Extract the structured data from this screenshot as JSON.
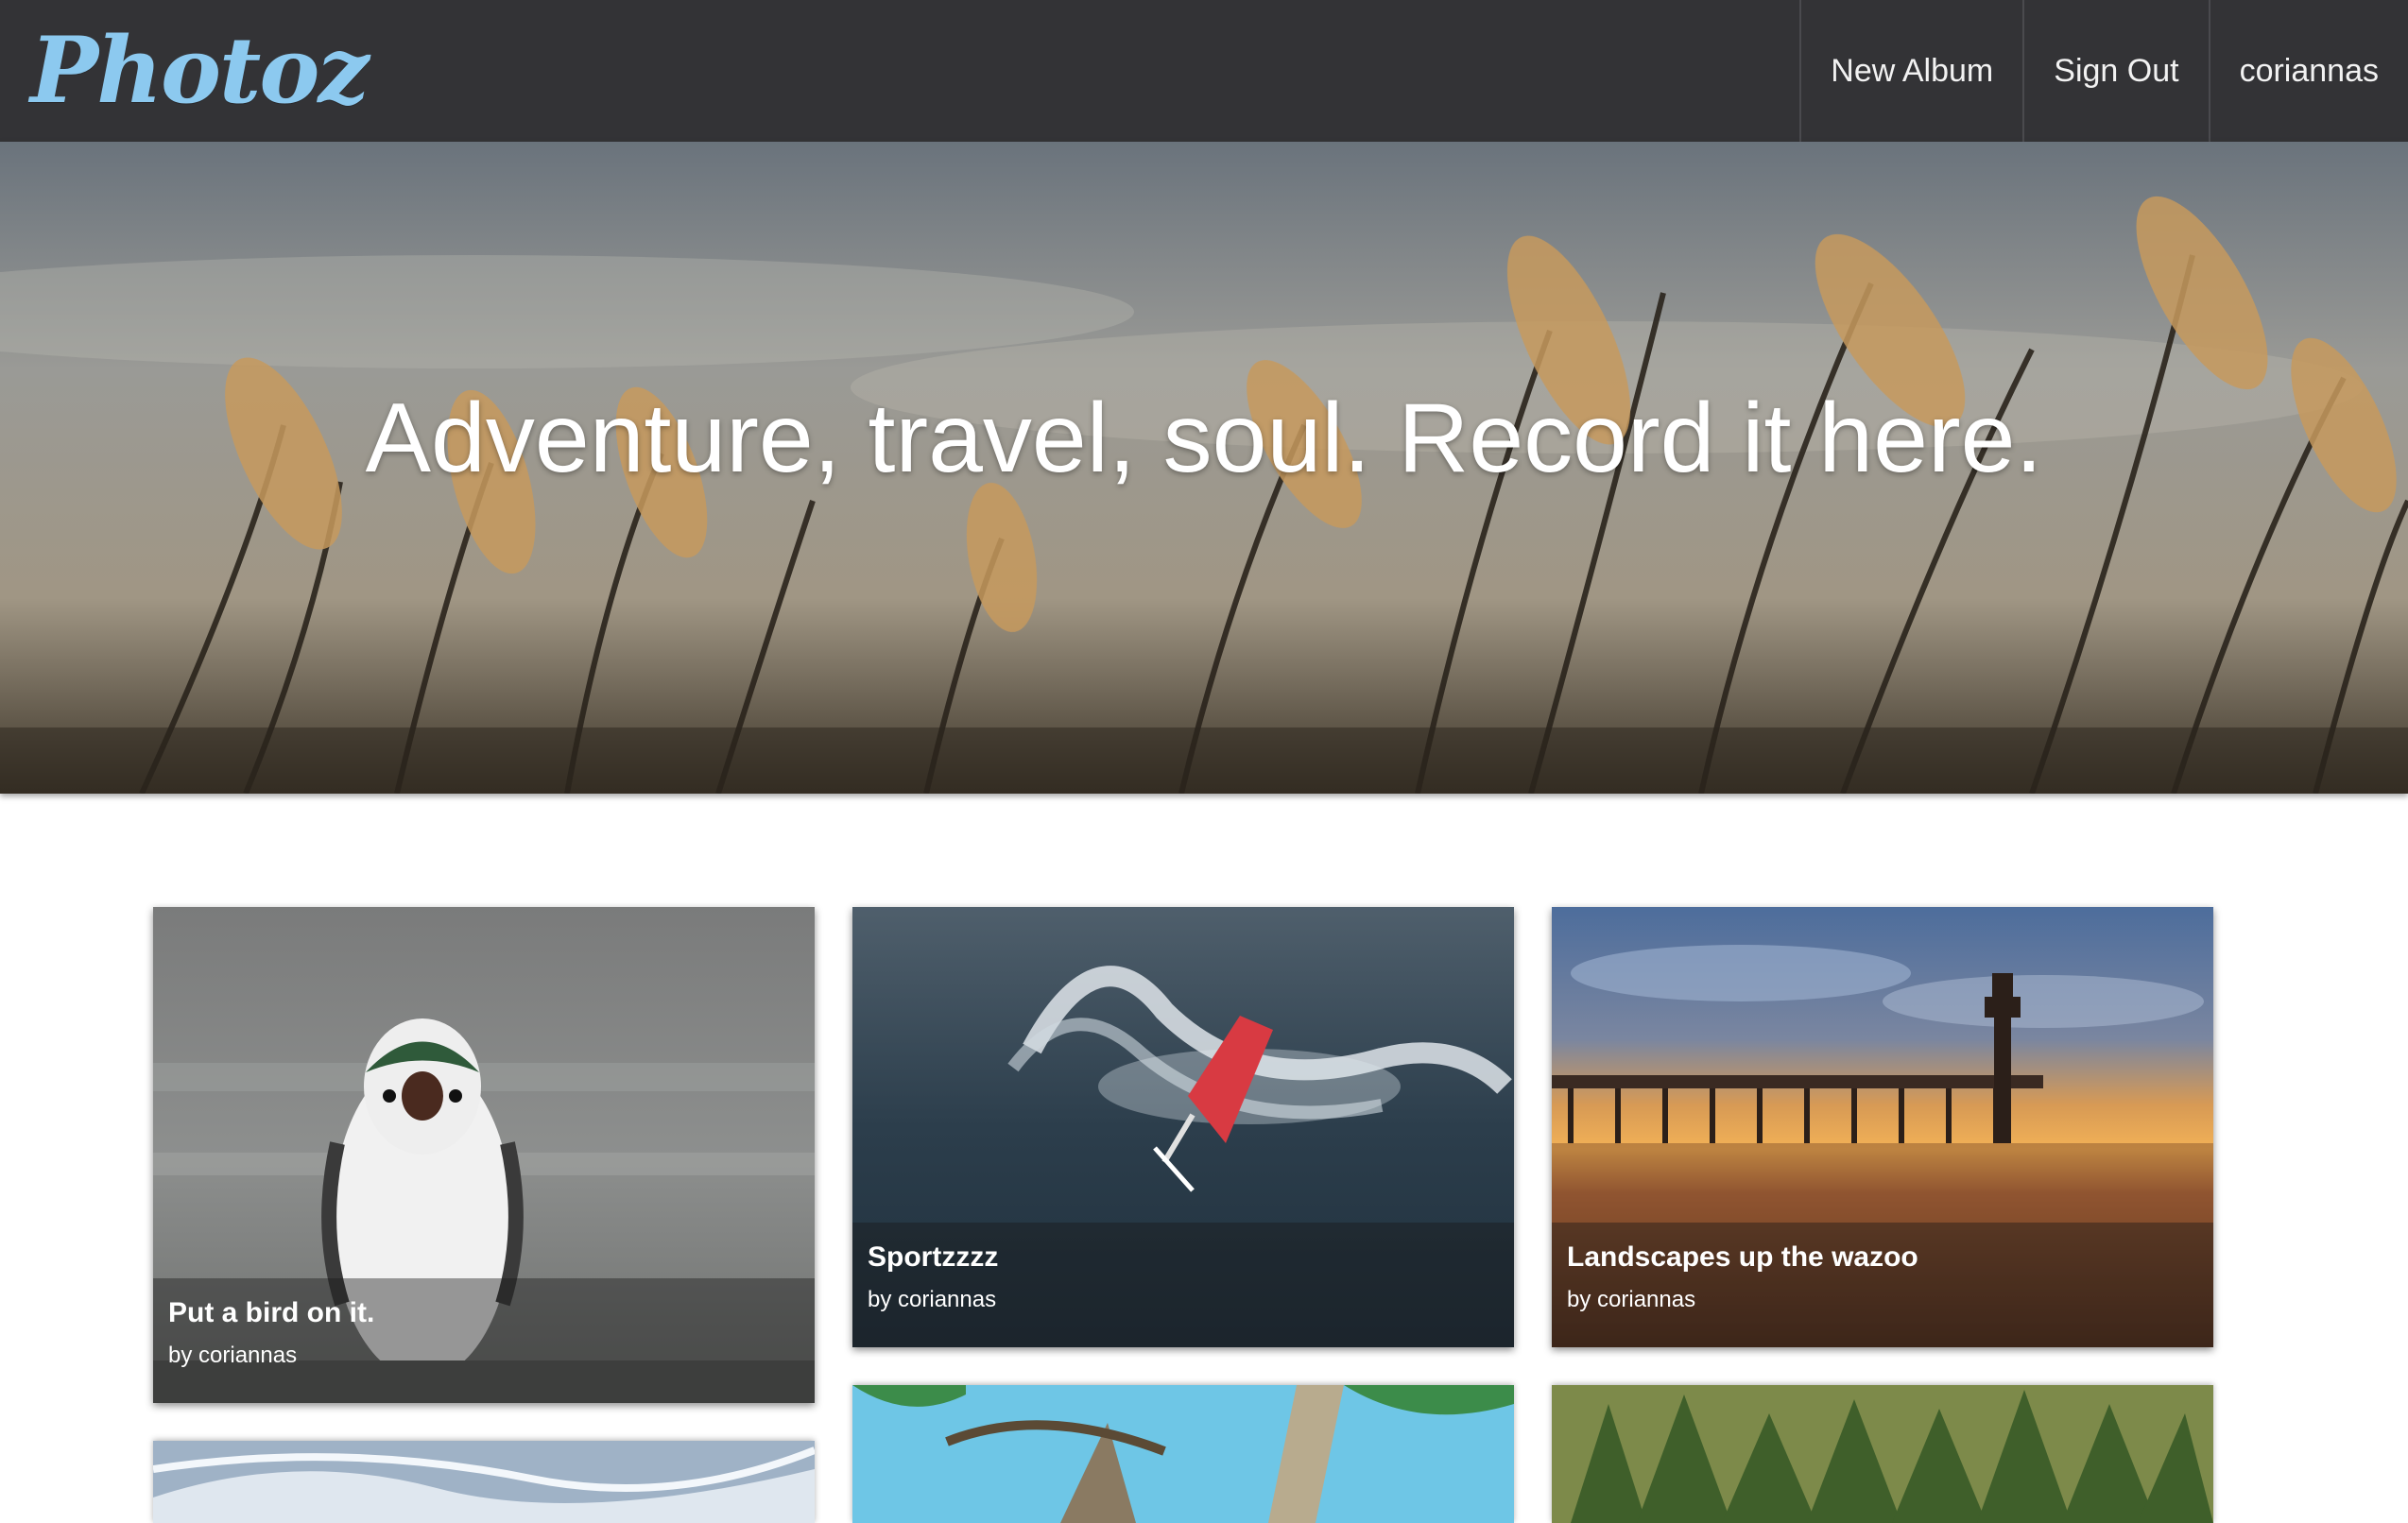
{
  "nav": {
    "brand": "Photoz",
    "links": [
      "New Album",
      "Sign Out",
      "coriannas"
    ]
  },
  "hero": {
    "headline": "Adventure, travel, soul. Record it here."
  },
  "albums": [
    {
      "title": "Put a bird on it.",
      "author": "by coriannas"
    },
    {
      "title": "Sportzzzz",
      "author": "by coriannas"
    },
    {
      "title": "Landscapes up the wazoo",
      "author": "by coriannas"
    }
  ],
  "colors": {
    "navbar": "#333336",
    "brand": "#8cc9ef",
    "page_background": "#ffffff"
  }
}
